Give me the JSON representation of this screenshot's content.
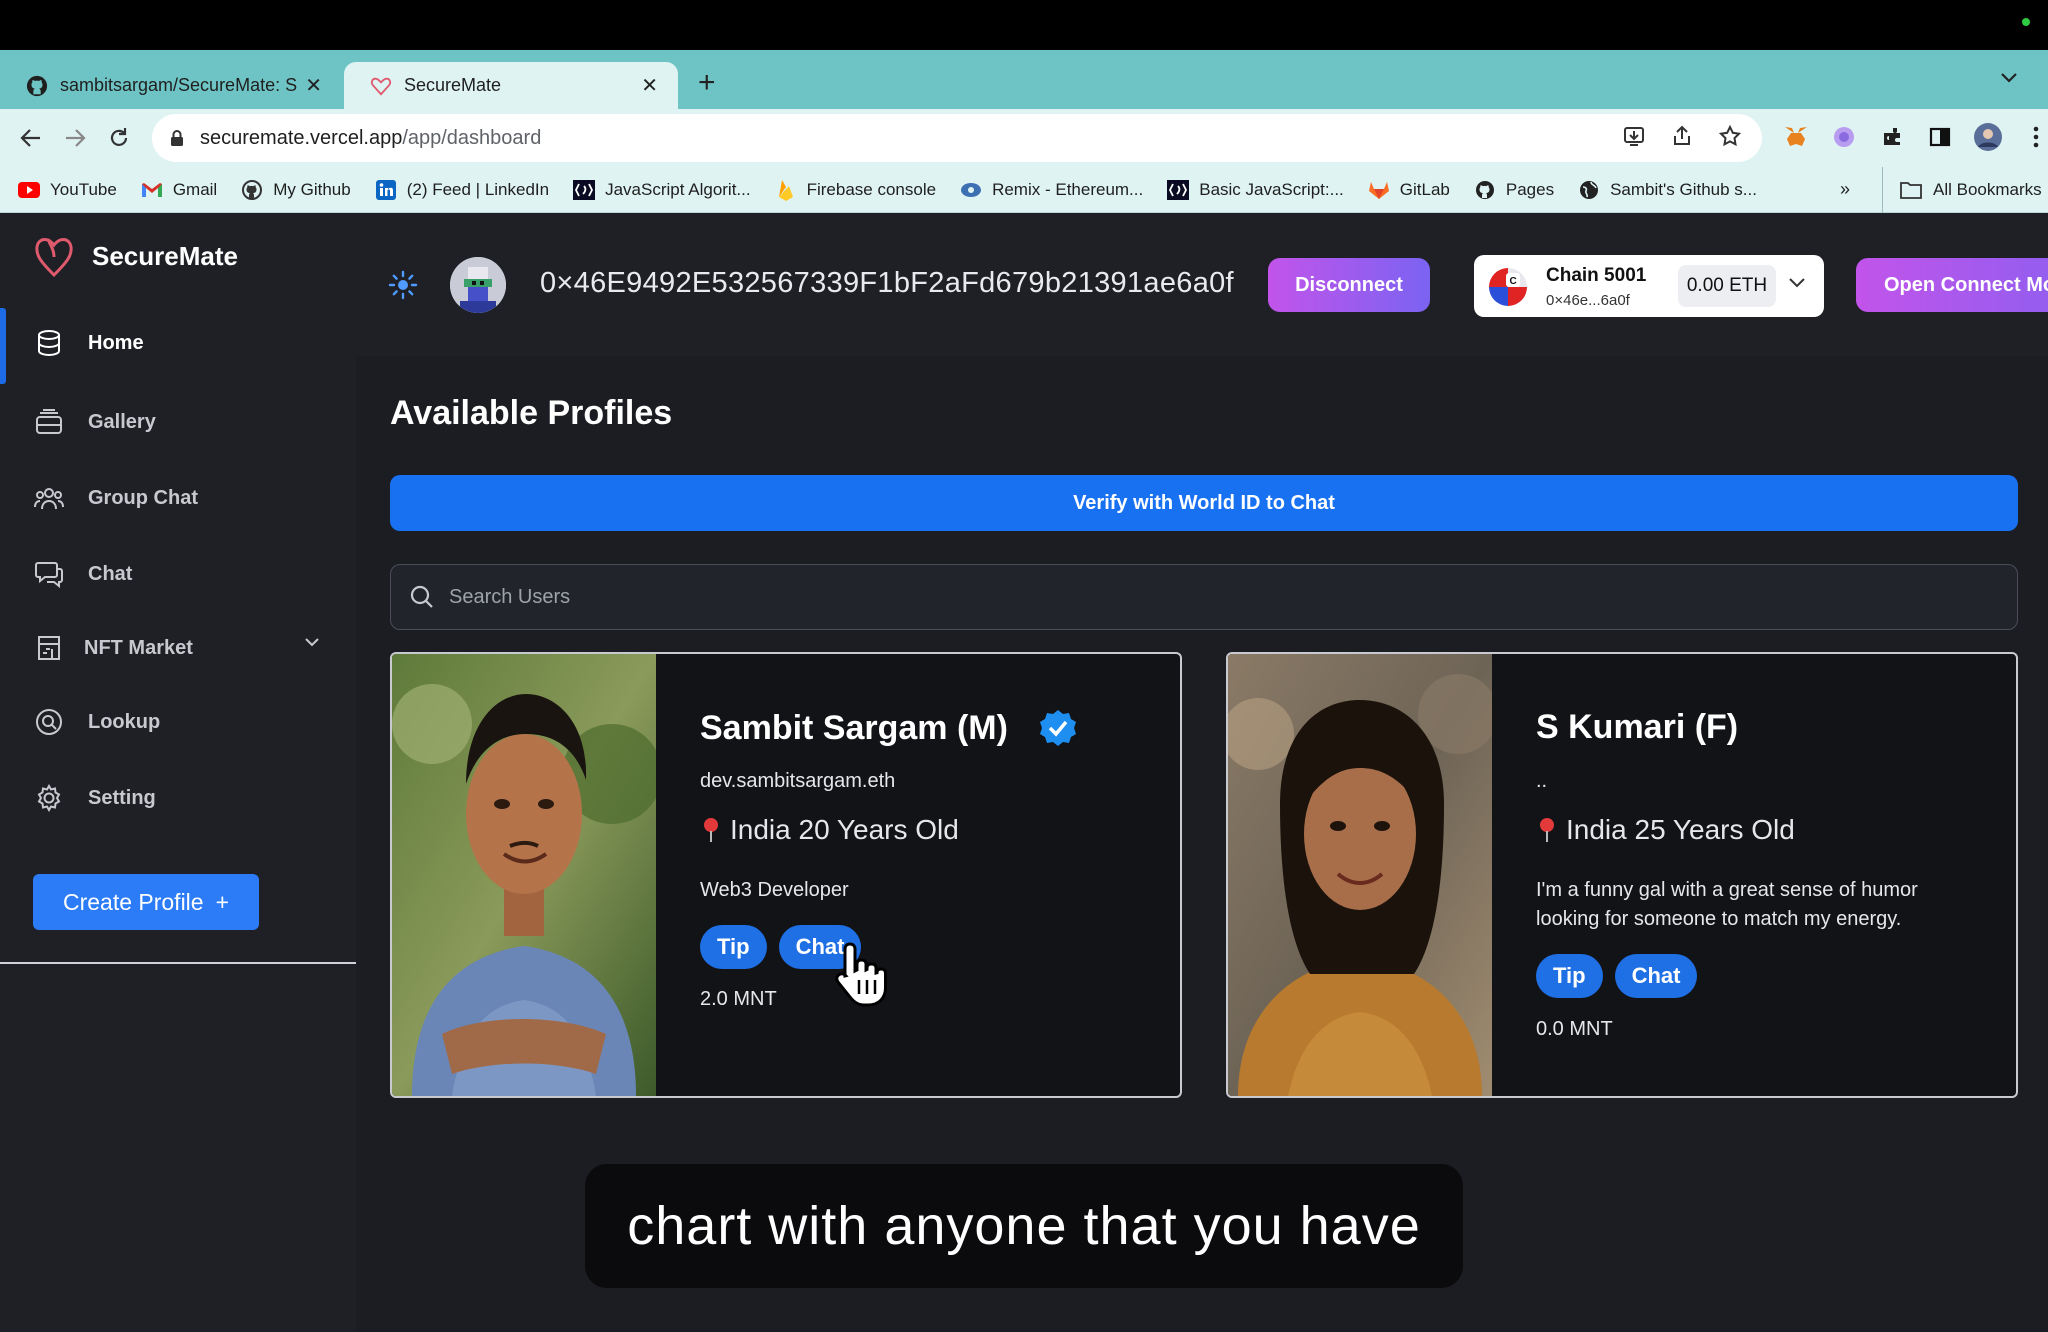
{
  "browser": {
    "tabs": [
      {
        "title": "sambitsargam/SecureMate: Se",
        "active": false
      },
      {
        "title": "SecureMate",
        "active": true
      }
    ],
    "url_host": "securemate.vercel.app",
    "url_path": "/app/dashboard",
    "bookmarks": [
      {
        "label": "YouTube",
        "icon": "youtube-icon"
      },
      {
        "label": "Gmail",
        "icon": "gmail-icon"
      },
      {
        "label": "My Github",
        "icon": "github-icon"
      },
      {
        "label": "(2) Feed | LinkedIn",
        "icon": "linkedin-icon"
      },
      {
        "label": "JavaScript Algorit...",
        "icon": "fcc-icon"
      },
      {
        "label": "Firebase console",
        "icon": "firebase-icon"
      },
      {
        "label": "Remix - Ethereum...",
        "icon": "remix-icon"
      },
      {
        "label": "Basic JavaScript:...",
        "icon": "fcc-icon"
      },
      {
        "label": "GitLab",
        "icon": "gitlab-icon"
      },
      {
        "label": "Pages",
        "icon": "github-icon"
      },
      {
        "label": "Sambit's Github s...",
        "icon": "globe-icon"
      }
    ],
    "bookmarks_more": "»",
    "all_bookmarks": "All Bookmarks"
  },
  "app": {
    "brand": "SecureMate",
    "nav": [
      {
        "label": "Home",
        "icon": "database-icon",
        "active": true
      },
      {
        "label": "Gallery",
        "icon": "gallery-icon"
      },
      {
        "label": "Group Chat",
        "icon": "group-icon"
      },
      {
        "label": "Chat",
        "icon": "chat-icon"
      },
      {
        "label": "NFT Market",
        "icon": "market-icon",
        "has_dropdown": true
      },
      {
        "label": "Lookup",
        "icon": "lookup-icon"
      },
      {
        "label": "Setting",
        "icon": "gear-icon"
      }
    ],
    "create_profile": "Create Profile",
    "create_profile_icon": "+",
    "header": {
      "wallet_address": "0×46E9492E532567339F1bF2aFd679b21391ae6a0f",
      "disconnect": "Disconnect",
      "chain_name": "Chain 5001",
      "chain_address": "0×46e...6a0f",
      "balance": "0.00 ETH",
      "open_connect": "Open Connect Mo"
    },
    "main": {
      "title": "Available Profiles",
      "verify_button": "Verify with World ID to Chat",
      "search_placeholder": "Search Users",
      "profiles": [
        {
          "name": "Sambit Sargam (M)",
          "verified": true,
          "handle": "dev.sambitsargam.eth",
          "location": "India 20 Years Old",
          "bio": "Web3 Developer",
          "tip": "Tip",
          "chat": "Chat",
          "balance": "2.0 MNT"
        },
        {
          "name": "S Kumari (F)",
          "verified": false,
          "handle": "..",
          "location": "India 25 Years Old",
          "bio": "I'm a funny gal with a great sense of humor looking for someone to match my energy.",
          "tip": "Tip",
          "chat": "Chat",
          "balance": "0.0 MNT"
        }
      ]
    },
    "caption": "chart with anyone that you have"
  },
  "colors": {
    "accent": "#1771f1",
    "gradient_start": "#c254ea",
    "gradient_end": "#7b63f2",
    "sidebar_bg": "#1e2026",
    "main_bg": "#1b1d23"
  }
}
